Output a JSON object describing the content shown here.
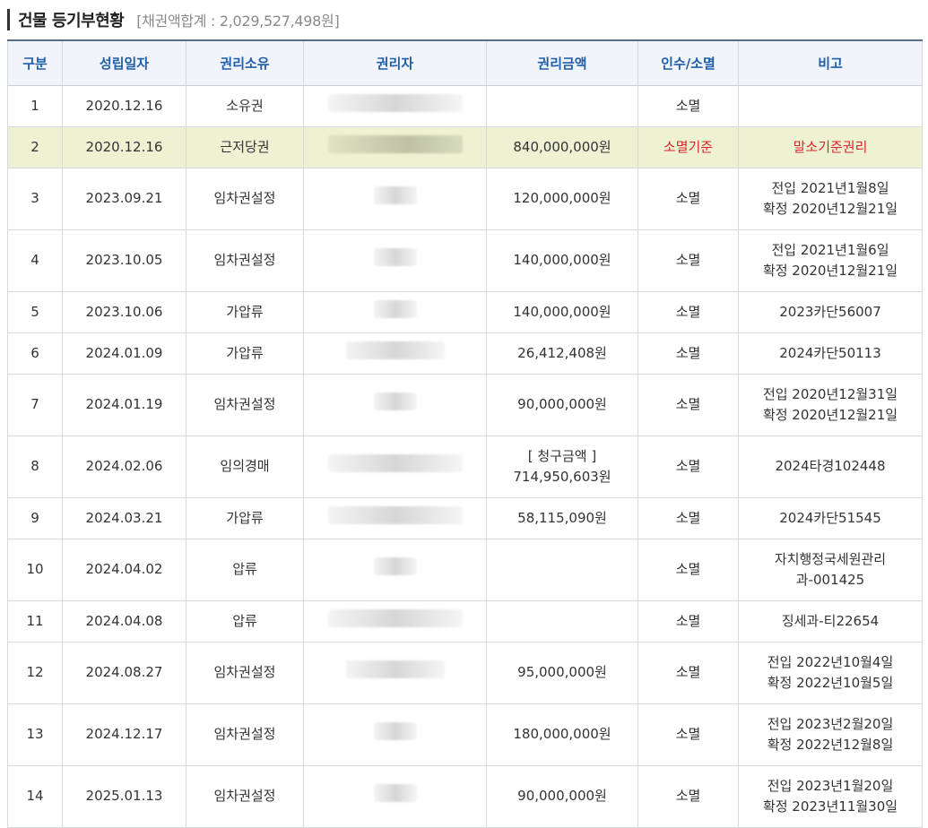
{
  "title": "건물 등기부현황",
  "total_label": "[채권액합계 : 2,029,527,498원]",
  "columns": [
    "구분",
    "성립일자",
    "권리소유",
    "권리자",
    "권리금액",
    "인수/소멸",
    "비고"
  ],
  "rows": [
    {
      "no": "1",
      "date": "2020.12.16",
      "type": "소유권",
      "amount": "",
      "status": "소멸",
      "note1": "",
      "note2": ""
    },
    {
      "no": "2",
      "date": "2020.12.16",
      "type": "근저당권",
      "amount": "840,000,000원",
      "status": "소멸기준",
      "note1": "말소기준권리",
      "note2": ""
    },
    {
      "no": "3",
      "date": "2023.09.21",
      "type": "임차권설정",
      "amount": "120,000,000원",
      "status": "소멸",
      "note1": "전입 2021년1월8일",
      "note2": "확정 2020년12월21일"
    },
    {
      "no": "4",
      "date": "2023.10.05",
      "type": "임차권설정",
      "amount": "140,000,000원",
      "status": "소멸",
      "note1": "전입 2021년1월6일",
      "note2": "확정 2020년12월21일"
    },
    {
      "no": "5",
      "date": "2023.10.06",
      "type": "가압류",
      "amount": "140,000,000원",
      "status": "소멸",
      "note1": "2023카단56007",
      "note2": ""
    },
    {
      "no": "6",
      "date": "2024.01.09",
      "type": "가압류",
      "amount": "26,412,408원",
      "status": "소멸",
      "note1": "2024카단50113",
      "note2": ""
    },
    {
      "no": "7",
      "date": "2024.01.19",
      "type": "임차권설정",
      "amount": "90,000,000원",
      "status": "소멸",
      "note1": "전입 2020년12월31일",
      "note2": "확정 2020년12월21일"
    },
    {
      "no": "8",
      "date": "2024.02.06",
      "type": "임의경매",
      "amount_label": "[ 청구금액 ]",
      "amount": "714,950,603원",
      "status": "소멸",
      "note1": "2024타경102448",
      "note2": ""
    },
    {
      "no": "9",
      "date": "2024.03.21",
      "type": "가압류",
      "amount": "58,115,090원",
      "status": "소멸",
      "note1": "2024카단51545",
      "note2": ""
    },
    {
      "no": "10",
      "date": "2024.04.02",
      "type": "압류",
      "amount": "",
      "status": "소멸",
      "note1": "자치행정국세원관리",
      "note2": "과-001425"
    },
    {
      "no": "11",
      "date": "2024.04.08",
      "type": "압류",
      "amount": "",
      "status": "소멸",
      "note1": "징세과-티22654",
      "note2": ""
    },
    {
      "no": "12",
      "date": "2024.08.27",
      "type": "임차권설정",
      "amount": "95,000,000원",
      "status": "소멸",
      "note1": "전입 2022년10월4일",
      "note2": "확정 2022년10월5일"
    },
    {
      "no": "13",
      "date": "2024.12.17",
      "type": "임차권설정",
      "amount": "180,000,000원",
      "status": "소멸",
      "note1": "전입 2023년2월20일",
      "note2": "확정 2022년12월8일"
    },
    {
      "no": "14",
      "date": "2025.01.13",
      "type": "임차권설정",
      "amount": "90,000,000원",
      "status": "소멸",
      "note1": "전입 2023년1월20일",
      "note2": "확정 2023년11월30일"
    }
  ],
  "colors": {
    "header_text": "#1f5ea8",
    "highlight_row": "#eff1d3",
    "red": "#d9262c"
  }
}
